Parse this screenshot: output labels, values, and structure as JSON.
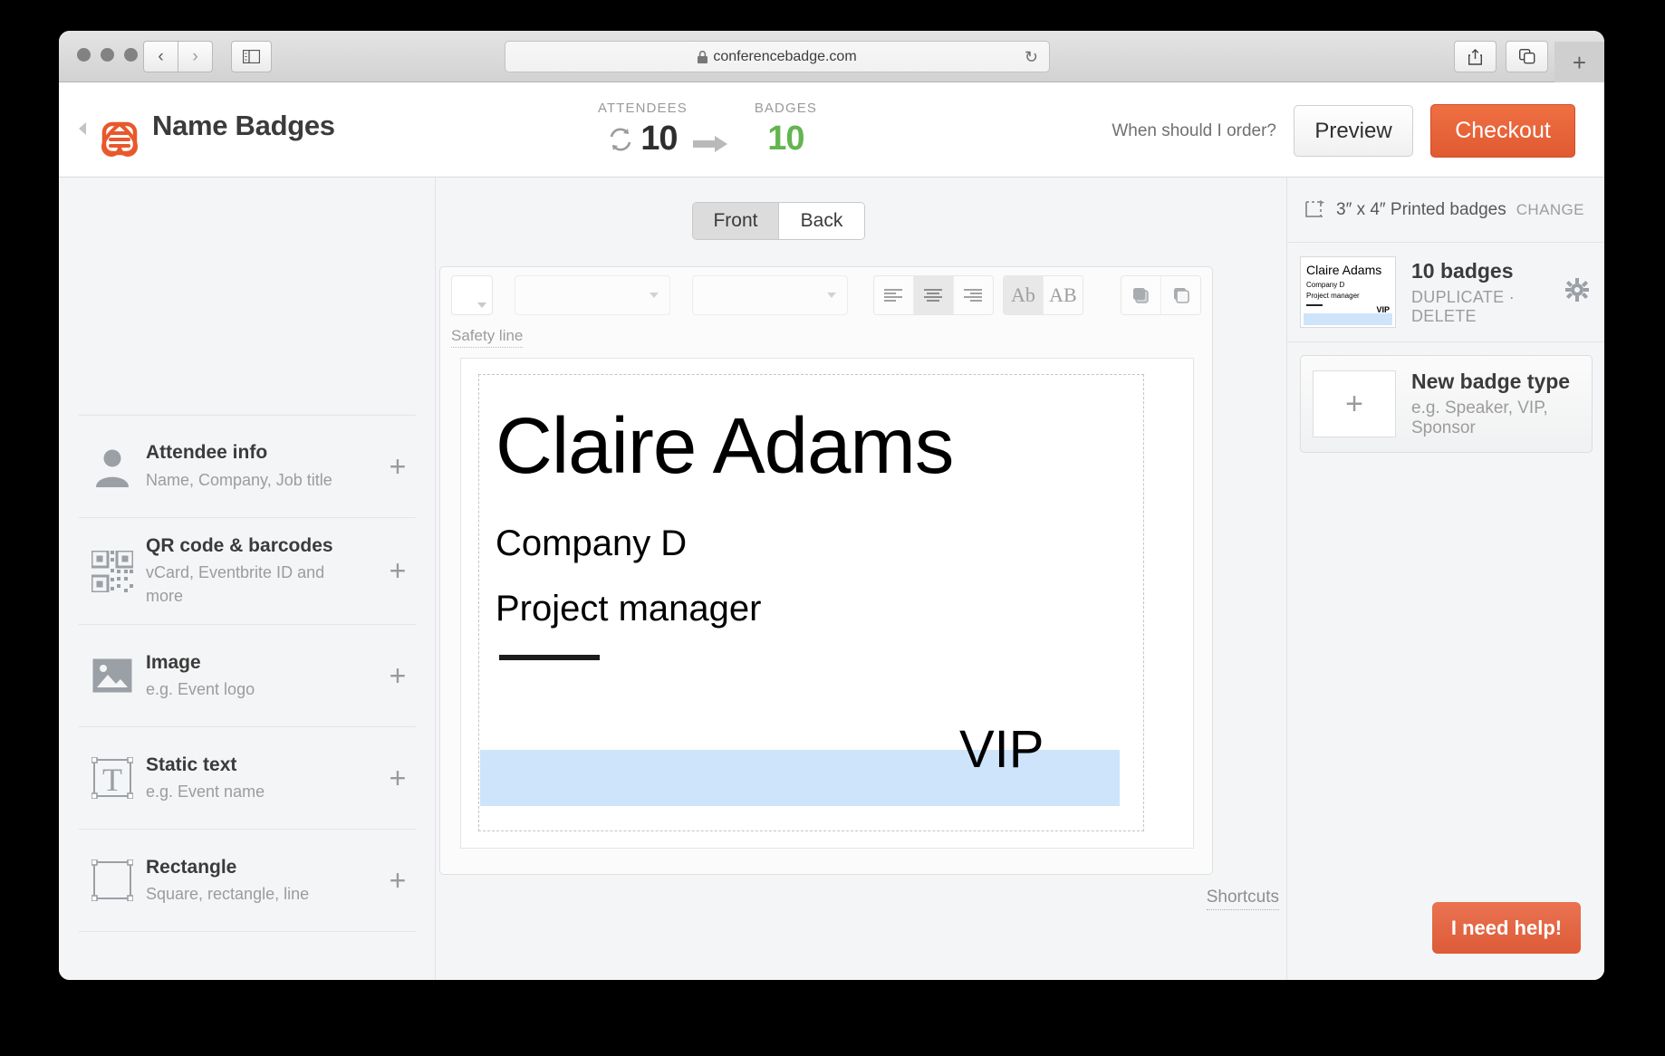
{
  "browser": {
    "url": "conferencebadge.com",
    "lock_icon": "lock-icon",
    "back_icon": "‹",
    "forward_icon": "›",
    "reload_icon": "↻",
    "new_tab_icon": "+"
  },
  "header": {
    "app_title": "Name Badges",
    "logo_icon": "badge-lanyard-logo",
    "attendees_label": "ATTENDEES",
    "attendees_value": "10",
    "badges_label": "BADGES",
    "badges_value": "10",
    "sync_icon": "sync-icon",
    "arrow_icon": "➡",
    "order_link": "When should I order?",
    "preview_label": "Preview",
    "checkout_label": "Checkout",
    "checkout_color": "#e35c33",
    "badges_value_color": "#64b450"
  },
  "sidebar": {
    "items": [
      {
        "title": "Attendee info",
        "sub": "Name, Company, Job title",
        "icon": "person-icon",
        "add": "+"
      },
      {
        "title": "QR code & barcodes",
        "sub": "vCard, Eventbrite ID and more",
        "icon": "qr-code-icon",
        "add": "+"
      },
      {
        "title": "Image",
        "sub": "e.g. Event logo",
        "icon": "image-icon",
        "add": "+"
      },
      {
        "title": "Static text",
        "sub": "e.g. Event name",
        "icon": "static-text-icon",
        "add": "+"
      },
      {
        "title": "Rectangle",
        "sub": "Square, rectangle, line",
        "icon": "rectangle-icon",
        "add": "+"
      }
    ]
  },
  "editor": {
    "tabs": [
      {
        "label": "Front",
        "active": true
      },
      {
        "label": "Back",
        "active": false
      }
    ],
    "toolbar": {
      "color_swatch": "",
      "font_family_value": "",
      "font_size_value": "",
      "align_left_icon": "align-left-icon",
      "align_center_icon": "align-center-icon",
      "align_right_icon": "align-right-icon",
      "case_mixed_label": "Ab",
      "case_upper_label": "AB",
      "bring_front_icon": "bring-to-front-icon",
      "send_back_icon": "send-to-back-icon"
    },
    "safety_line_label": "Safety line",
    "shortcuts_label": "Shortcuts"
  },
  "badge": {
    "name": "Claire Adams",
    "company": "Company D",
    "role": "Project manager",
    "vip": "VIP",
    "band_color": "#cde4fb"
  },
  "right_panel": {
    "size_icon": "crop-size-icon",
    "size_label": "3″ x 4″ Printed badges",
    "change_label": "CHANGE",
    "badge_type": {
      "count_label": "10 badges",
      "duplicate_label": "DUPLICATE",
      "separator": "·",
      "delete_label": "DELETE",
      "gear_icon": "gear-icon",
      "thumbnail": {
        "name": "Claire Adams",
        "company": "Company D",
        "role": "Project manager",
        "vip": "VIP"
      }
    },
    "new_badge_type": {
      "add_icon": "+",
      "title": "New badge type",
      "sub": "e.g. Speaker, VIP, Sponsor"
    }
  },
  "help": {
    "label": "I need help!"
  }
}
